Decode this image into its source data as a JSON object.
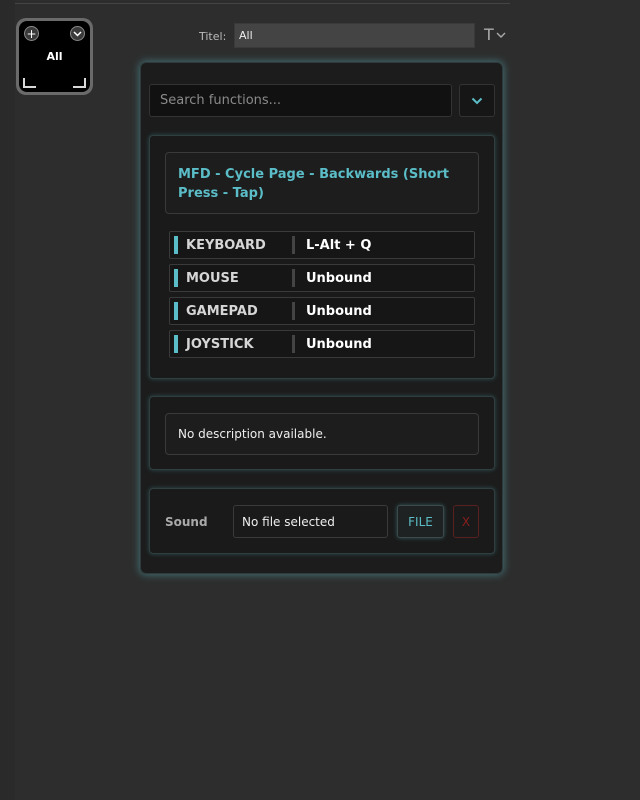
{
  "key": {
    "label": "All",
    "add_symbol": "+",
    "menu_symbol": "⌄"
  },
  "title_field": {
    "label": "Titel:",
    "value": "All",
    "font_toggle_symbol": "T"
  },
  "search": {
    "placeholder": "Search functions..."
  },
  "function": {
    "name": "MFD - Cycle Page - Backwards (Short Press - Tap)",
    "bindings": [
      {
        "device": "KEYBOARD",
        "value": "L-Alt + Q"
      },
      {
        "device": "MOUSE",
        "value": "Unbound"
      },
      {
        "device": "GAMEPAD",
        "value": "Unbound"
      },
      {
        "device": "JOYSTICK",
        "value": "Unbound"
      }
    ]
  },
  "description": {
    "text": "No description available."
  },
  "sound": {
    "label": "Sound",
    "file": "No file selected",
    "file_button": "FILE",
    "clear_button": "X"
  },
  "colors": {
    "accent": "#5bbdc7",
    "danger": "#8a1e1e",
    "background": "#2d2d2d",
    "panel": "#1c1c1c"
  },
  "icons": {
    "dropdown": "chevron-down-icon",
    "font_toggle": "text-font-icon",
    "add": "plus-icon"
  }
}
